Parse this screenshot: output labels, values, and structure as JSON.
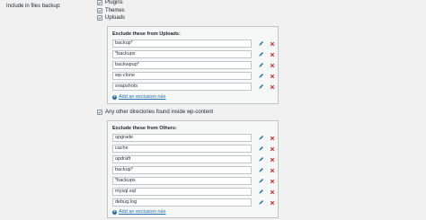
{
  "label_include": "Include in files backup:",
  "checks": {
    "plugins": "Plugins",
    "themes": "Themes",
    "uploads": "Uploads",
    "others": "Any other directories found inside wp-content"
  },
  "uploads_panel": {
    "title": "Exclude these from Uploads:",
    "rules": [
      "backup*",
      "*backups",
      "backwpup*",
      "wp-clone",
      "snapshots"
    ],
    "add_label": "Add an exclusion rule"
  },
  "others_panel": {
    "title": "Exclude these from Others:",
    "rules": [
      "upgrade",
      "cache",
      "updraft",
      "backup*",
      "*backups",
      "mysql.sql",
      "debug.log"
    ],
    "add_label": "Add an exclusion rule"
  },
  "colors": {
    "accent": "#2271b1",
    "delete": "#d63638"
  }
}
